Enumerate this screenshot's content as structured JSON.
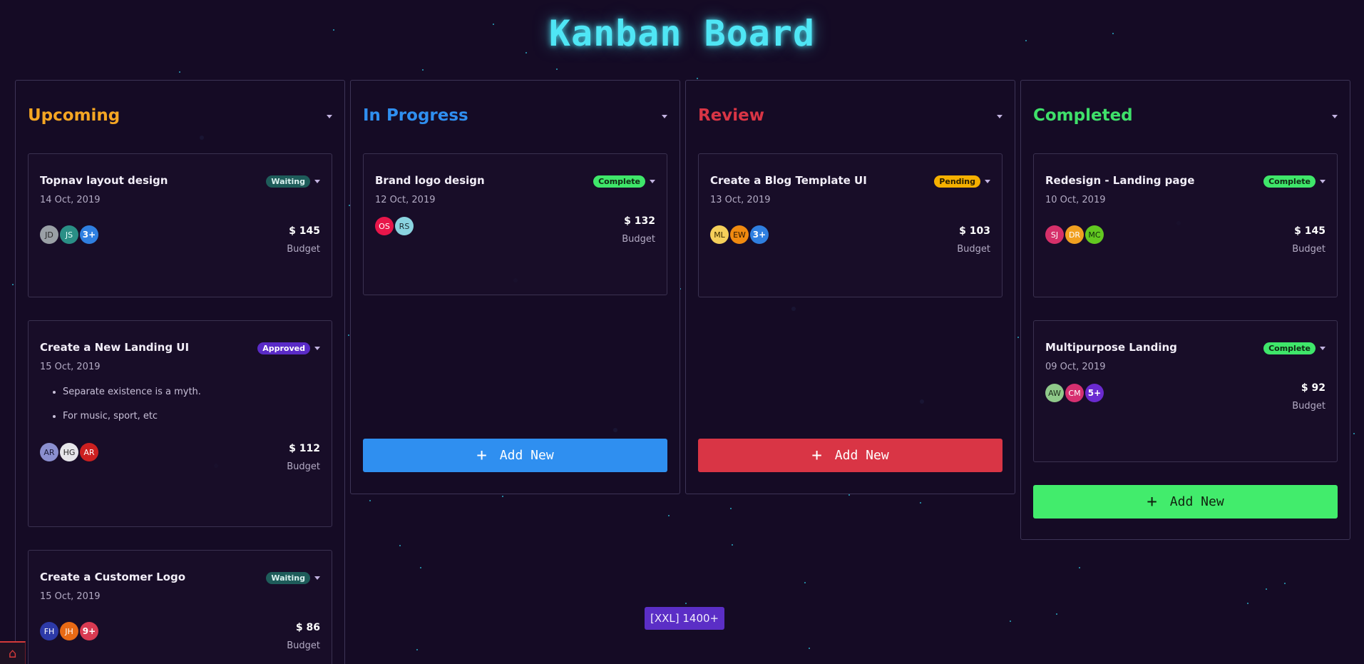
{
  "app": {
    "title": "Kanban Board"
  },
  "breakpoint_badge": "[XXL] 1400+",
  "columns": [
    {
      "title": "Upcoming",
      "color": "#f5a623",
      "cards": [
        {
          "title": "Topnav layout design",
          "status": "Waiting",
          "status_bg": "#1e5c5a",
          "status_fg": "#d8f0ee",
          "date": "14 Oct, 2019",
          "avatars": [
            {
              "initials": "JD",
              "bg": "#9aa0a6",
              "fg": "#2a2a2a"
            },
            {
              "initials": "JS",
              "bg": "#2a8f86",
              "fg": "#e6fffb"
            },
            {
              "initials": "3+",
              "bg": "#2f7fe0",
              "fg": "#ffffff"
            }
          ],
          "price": "$ 145",
          "price_label": "Budget"
        },
        {
          "title": "Create a New Landing UI",
          "status": "Approved",
          "status_bg": "#5a2bc7",
          "status_fg": "#ffffff",
          "date": "15 Oct, 2019",
          "notes": [
            "Separate existence is a myth.",
            "For music, sport, etc"
          ],
          "avatars": [
            {
              "initials": "AR",
              "bg": "#8b8fd0",
              "fg": "#1c1c3a"
            },
            {
              "initials": "HG",
              "bg": "#e6e6ea",
              "fg": "#2a2a2a"
            },
            {
              "initials": "AR",
              "bg": "#cc2020",
              "fg": "#ffffff"
            }
          ],
          "price": "$ 112",
          "price_label": "Budget"
        },
        {
          "title": "Create a Customer Logo",
          "status": "Waiting",
          "status_bg": "#1e5c5a",
          "status_fg": "#d8f0ee",
          "date": "15 Oct, 2019",
          "avatars": [
            {
              "initials": "FH",
              "bg": "#2d3aa8",
              "fg": "#ffffff"
            },
            {
              "initials": "JH",
              "bg": "#e86a15",
              "fg": "#ffffff"
            },
            {
              "initials": "9+",
              "bg": "#d93a52",
              "fg": "#ffffff"
            }
          ],
          "price": "$ 86",
          "price_label": "Budget"
        }
      ]
    },
    {
      "title": "In Progress",
      "color": "#2f8ff0",
      "add_label": "Add New",
      "cards": [
        {
          "title": "Brand logo design",
          "status": "Complete",
          "status_bg": "#3fe66a",
          "status_fg": "#0f2a14",
          "date": "12 Oct, 2019",
          "avatars": [
            {
              "initials": "OS",
              "bg": "#e8164a",
              "fg": "#ffffff"
            },
            {
              "initials": "RS",
              "bg": "#8ad3e0",
              "fg": "#1a2a30"
            }
          ],
          "price": "$ 132",
          "price_label": "Budget"
        }
      ]
    },
    {
      "title": "Review",
      "color": "#d93545",
      "add_label": "Add New",
      "cards": [
        {
          "title": "Create a Blog Template UI",
          "status": "Pending",
          "status_bg": "#f5b000",
          "status_fg": "#2a1f00",
          "date": "13 Oct, 2019",
          "avatars": [
            {
              "initials": "ML",
              "bg": "#f5cf5a",
              "fg": "#3a2a00"
            },
            {
              "initials": "EW",
              "bg": "#f08a10",
              "fg": "#2a1400"
            },
            {
              "initials": "3+",
              "bg": "#2f7fe0",
              "fg": "#ffffff"
            }
          ],
          "price": "$ 103",
          "price_label": "Budget"
        }
      ]
    },
    {
      "title": "Completed",
      "color": "#3fe06a",
      "add_label": "Add New",
      "cards": [
        {
          "title": "Redesign - Landing page",
          "status": "Complete",
          "status_bg": "#3fe66a",
          "status_fg": "#0f2a14",
          "date": "10 Oct, 2019",
          "avatars": [
            {
              "initials": "SJ",
              "bg": "#d6306a",
              "fg": "#ffffff"
            },
            {
              "initials": "DR",
              "bg": "#f0a020",
              "fg": "#ffffff"
            },
            {
              "initials": "MC",
              "bg": "#62c820",
              "fg": "#0f2a0a"
            }
          ],
          "price": "$ 145",
          "price_label": "Budget"
        },
        {
          "title": "Multipurpose Landing",
          "status": "Complete",
          "status_bg": "#3fe66a",
          "status_fg": "#0f2a14",
          "date": "09 Oct, 2019",
          "avatars": [
            {
              "initials": "AW",
              "bg": "#8fc98a",
              "fg": "#1a2a18"
            },
            {
              "initials": "CM",
              "bg": "#d63070",
              "fg": "#ffffff"
            },
            {
              "initials": "5+",
              "bg": "#6a2ad0",
              "fg": "#ffffff"
            }
          ],
          "price": "$ 92",
          "price_label": "Budget"
        }
      ]
    }
  ]
}
